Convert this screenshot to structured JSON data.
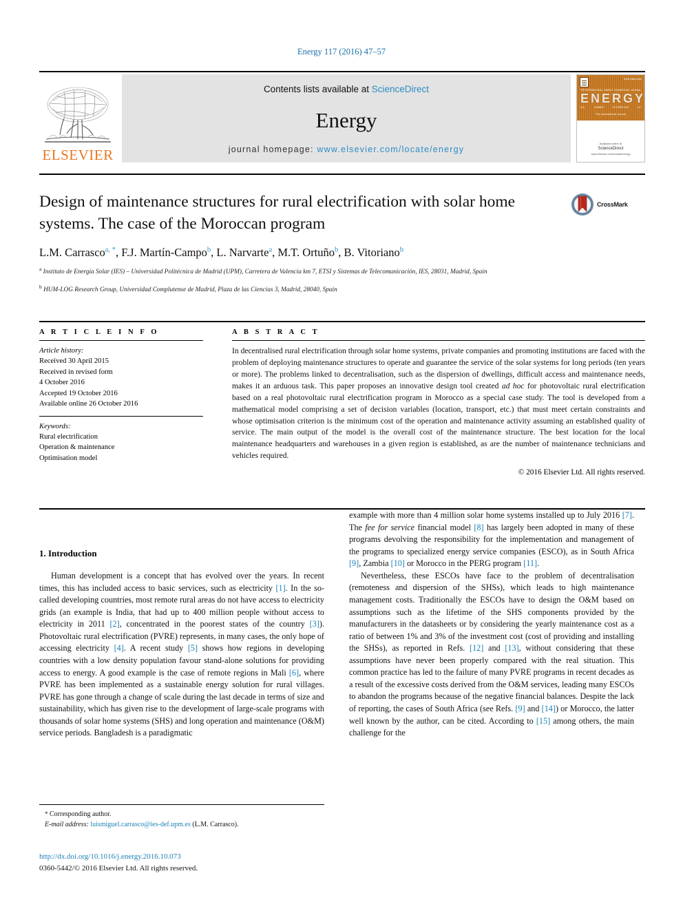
{
  "running_head": "Energy 117 (2016) 47–57",
  "masthead": {
    "publisher_word": "ELSEVIER",
    "contents_prefix": "Contents lists available at ",
    "contents_link": "ScienceDirect",
    "journal_name": "Energy",
    "homepage_prefix": "journal homepage: ",
    "homepage_url": "www.elsevier.com/locate/energy",
    "cover": {
      "issue_code": "ISSN 0360-5442",
      "title": "ENERGY",
      "top_row": [
        "THE INTERNATIONAL",
        "ENERGY",
        "ENGINEERING",
        "JOURNAL"
      ],
      "bottom_row": [
        "VOL.",
        "NUMBER",
        "OCTOBER 2016",
        "117"
      ],
      "subtitle": "The International Journal",
      "publisher_small": "Available online at",
      "publisher_name": "ScienceDirect",
      "publisher_url": "www.elsevier.com/locate/energy"
    }
  },
  "article": {
    "title": "Design of maintenance structures for rural electrification with solar home systems. The case of the Moroccan program",
    "crossmark_label": "CrossMark",
    "authors": [
      {
        "name": "L.M. Carrasco",
        "marks": "a, *"
      },
      {
        "name": "F.J. Martín-Campo",
        "marks": "b"
      },
      {
        "name": "L. Narvarte",
        "marks": "a"
      },
      {
        "name": "M.T. Ortuño",
        "marks": "b"
      },
      {
        "name": "B. Vitoriano",
        "marks": "b"
      }
    ],
    "affiliations": [
      {
        "mark": "a",
        "text": "Instituto de Energía Solar (IES) – Universidad Politécnica de Madrid (UPM), Carretera de Valencia km 7, ETSI y Sistemas de Telecomunicación, IES, 28031, Madrid, Spain"
      },
      {
        "mark": "b",
        "text": "HUM-LOG Research Group, Universidad Complutense de Madrid, Plaza de las Ciencias 3, Madrid, 28040, Spain"
      }
    ]
  },
  "article_info": {
    "heading": "A R T I C L E   I N F O",
    "history_label": "Article history:",
    "history": [
      "Received 30 April 2015",
      "Received in revised form",
      "4 October 2016",
      "Accepted 19 October 2016",
      "Available online 26 October 2016"
    ],
    "keywords_label": "Keywords:",
    "keywords": [
      "Rural electrification",
      "Operation & maintenance",
      "Optimisation model"
    ]
  },
  "abstract": {
    "heading": "A B S T R A C T",
    "paragraph_1": "In decentralised rural electrification through solar home systems, private companies and promoting institutions are faced with the problem of deploying maintenance structures to operate and guarantee the service of the solar systems for long periods (ten years or more). The problems linked to decentralisation, such as the dispersion of dwellings, difficult access and maintenance needs, makes it an arduous task. This paper proposes an innovative design tool created ",
    "italic_1": "ad hoc",
    "paragraph_2": " for photovoltaic rural electrification based on a real photovoltaic rural electrification program in Morocco as a special case study. The tool is developed from a mathematical model comprising a set of decision variables (location, transport, etc.) that must meet certain constraints and whose optimisation criterion is the minimum cost of the operation and maintenance activity assuming an established quality of service. The main output of the model is the overall cost of the maintenance structure. The best location for the local maintenance headquarters and warehouses in a given region is established, as are the number of maintenance technicians and vehicles required.",
    "copyright": "© 2016 Elsevier Ltd. All rights reserved."
  },
  "introduction": {
    "heading": "1. Introduction",
    "left_para_1": {
      "s1": "Human development is a concept that has evolved over the years. In recent times, this has included access to basic services, such as electricity ",
      "r1": "[1]",
      "s2": ". In the so-called developing countries, most remote rural areas do not have access to electricity grids (an example is India, that had up to 400 million people without access to electricity in 2011 ",
      "r2": "[2]",
      "s3": ", concentrated in the poorest states of the country ",
      "r3": "[3]",
      "s4": "). Photovoltaic rural electrification (PVRE) represents, in many cases, the only hope of accessing electricity ",
      "r4": "[4]",
      "s5": ". A recent study ",
      "r5": "[5]",
      "s6": " shows how regions in developing countries with a low density population favour stand-alone solutions for providing access to energy. A good example is the case of remote regions in Mali ",
      "r6": "[6]",
      "s7": ", where PVRE has been implemented as a sustainable energy solution for rural villages. PVRE has gone through a change of scale during the last decade in terms of size and sustainability, which has given rise to the development of large-scale programs with thousands of solar home systems (SHS) and long operation and maintenance (O&M) service periods. Bangladesh is a paradigmatic"
    },
    "right_para_1": {
      "s1": "example with more than 4 million solar home systems installed up to July 2016 ",
      "r1": "[7]",
      "s2": ". The ",
      "i1": "fee for service",
      "s3": " financial model ",
      "r2": "[8]",
      "s4": " has largely been adopted in many of these programs devolving the responsibility for the implementation and management of the programs to specialized energy service companies (ESCO), as in South Africa ",
      "r3": "[9]",
      "s5": ", Zambia ",
      "r4": "[10]",
      "s6": " or Morocco in the PERG program ",
      "r5": "[11]",
      "s7": "."
    },
    "right_para_2": {
      "s1": "Nevertheless, these ESCOs have face to the problem of decentralisation (remoteness and dispersion of the SHSs), which leads to high maintenance management costs. Traditionally the ESCOs have to design the O&M based on assumptions such as the lifetime of the SHS components provided by the manufacturers in the datasheets or by considering the yearly maintenance cost as a ratio of between 1% and 3% of the investment cost (cost of providing and installing the SHSs), as reported in Refs. ",
      "r1": "[12]",
      "s2": " and ",
      "r2": "[13]",
      "s3": ", without considering that these assumptions have never been properly compared with the real situation. This common practice has led to the failure of many PVRE programs in recent decades as a result of the excessive costs derived from the O&M services, leading many ESCOs to abandon the programs because of the negative financial balances. Despite the lack of reporting, the cases of South Africa (see Refs. ",
      "r3": "[9]",
      "s4": " and ",
      "r4": "[14]",
      "s5": ") or Morocco, the latter well known by the author, can be cited. According to ",
      "r5": "[15]",
      "s6": " among others, the main challenge for the"
    }
  },
  "footer": {
    "corresponding_author": "Corresponding author.",
    "email_label": "E-mail address:",
    "email": "luismiguel.carrasco@ies-def.upm.es",
    "email_owner": "(L.M. Carrasco).",
    "doi": "http://dx.doi.org/10.1016/j.energy.2016.10.073",
    "issn": "0360-5442/© 2016 Elsevier Ltd. All rights reserved."
  },
  "colors": {
    "link": "#1a7fb5",
    "elsevier_orange": "#E87722",
    "band_gray": "#e3e3e3"
  }
}
